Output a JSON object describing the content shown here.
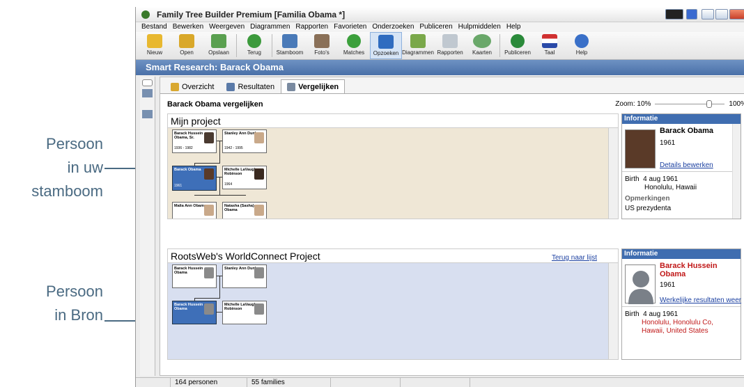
{
  "callouts": {
    "tree_person": [
      "Persoon",
      "in uw",
      "stamboom"
    ],
    "source_person": [
      "Persoon",
      "in Bron"
    ]
  },
  "window": {
    "title": "Family Tree Builder Premium [Familia Obama *]"
  },
  "menu": [
    "Bestand",
    "Bewerken",
    "Weergeven",
    "Diagrammen",
    "Rapporten",
    "Favorieten",
    "Onderzoeken",
    "Publiceren",
    "Hulpmiddelen",
    "Help"
  ],
  "toolbar": [
    {
      "label": "Nieuw",
      "icon": "new-icon",
      "color": "#e8b830"
    },
    {
      "label": "Open",
      "icon": "open-folder-icon",
      "color": "#d9a82a"
    },
    {
      "label": "Opslaan",
      "icon": "save-icon",
      "color": "#5aa050"
    },
    {
      "label": "Terug",
      "icon": "back-arrow-icon",
      "color": "#3c9a3c"
    },
    {
      "label": "Stamboom",
      "icon": "family-tree-icon",
      "color": "#4a7ab8"
    },
    {
      "label": "Foto's",
      "icon": "photos-icon",
      "color": "#8a7058"
    },
    {
      "label": "Matches",
      "icon": "matches-icon",
      "color": "#3ca03c"
    },
    {
      "label": "Opzoeken",
      "icon": "search-arrow-icon",
      "color": "#2f6cc0"
    },
    {
      "label": "Diagrammen",
      "icon": "charts-icon",
      "color": "#7aa84a"
    },
    {
      "label": "Rapporten",
      "icon": "reports-icon",
      "color": "#c0c8d0"
    },
    {
      "label": "Kaarten",
      "icon": "maps-icon",
      "color": "#6aa86a"
    },
    {
      "label": "Publiceren",
      "icon": "publish-globe-icon",
      "color": "#2a8a3a"
    },
    {
      "label": "Taal",
      "icon": "language-flag-icon",
      "color": "#d03030"
    },
    {
      "label": "Help",
      "icon": "help-icon",
      "color": "#3a70c8"
    }
  ],
  "smart_research_title": "Smart Research: Barack Obama",
  "tabs": [
    "Overzicht",
    "Resultaten",
    "Vergelijken"
  ],
  "compare_title": "Barack Obama vergelijken",
  "zoom": {
    "label": "Zoom: 10%",
    "max": "100%",
    "level": 80
  },
  "project": {
    "title": "Mijn project",
    "people": [
      {
        "name": "Barack Hussein Obama, Sr.",
        "years": "1936 - 1982"
      },
      {
        "name": "Stanley Ann Dunham",
        "years": "1942 - 1995"
      },
      {
        "name": "Barack Obama",
        "years": "1961"
      },
      {
        "name": "Michelle LaVaughn Robinson",
        "years": "1964"
      },
      {
        "name": "Malia Ann Obama",
        "years": ""
      },
      {
        "name": "Natasha (Sasha) Obama",
        "years": ""
      }
    ]
  },
  "project_info": {
    "header": "Informatie",
    "name": "Barack Obama",
    "year": "1961",
    "link": "Details bewerken",
    "birth_label": "Birth",
    "birth_date": "4 aug 1961",
    "birth_place": "Honolulu, Hawaii",
    "notes_label": "Opmerkingen",
    "notes": "US prezydenta"
  },
  "source": {
    "title": "RootsWeb's WorldConnect Project",
    "back_link": "Terug naar lijst",
    "people": [
      {
        "name": "Barack Hussein Obama"
      },
      {
        "name": "Stanley Ann Dunham"
      },
      {
        "name": "Barack Hussein Obama"
      },
      {
        "name": "Michelle LaVaughn Robinson"
      }
    ]
  },
  "source_info": {
    "header": "Informatie",
    "name": "Barack Hussein Obama",
    "year": "1961",
    "link": "Werkelijke resultaten weer",
    "birth_label": "Birth",
    "birth_date": "4 aug 1961",
    "birth_place": "Honolulu, Honolulu Co, Hawaii, United States"
  },
  "status": {
    "persons": "164 personen",
    "families": "55 families"
  }
}
